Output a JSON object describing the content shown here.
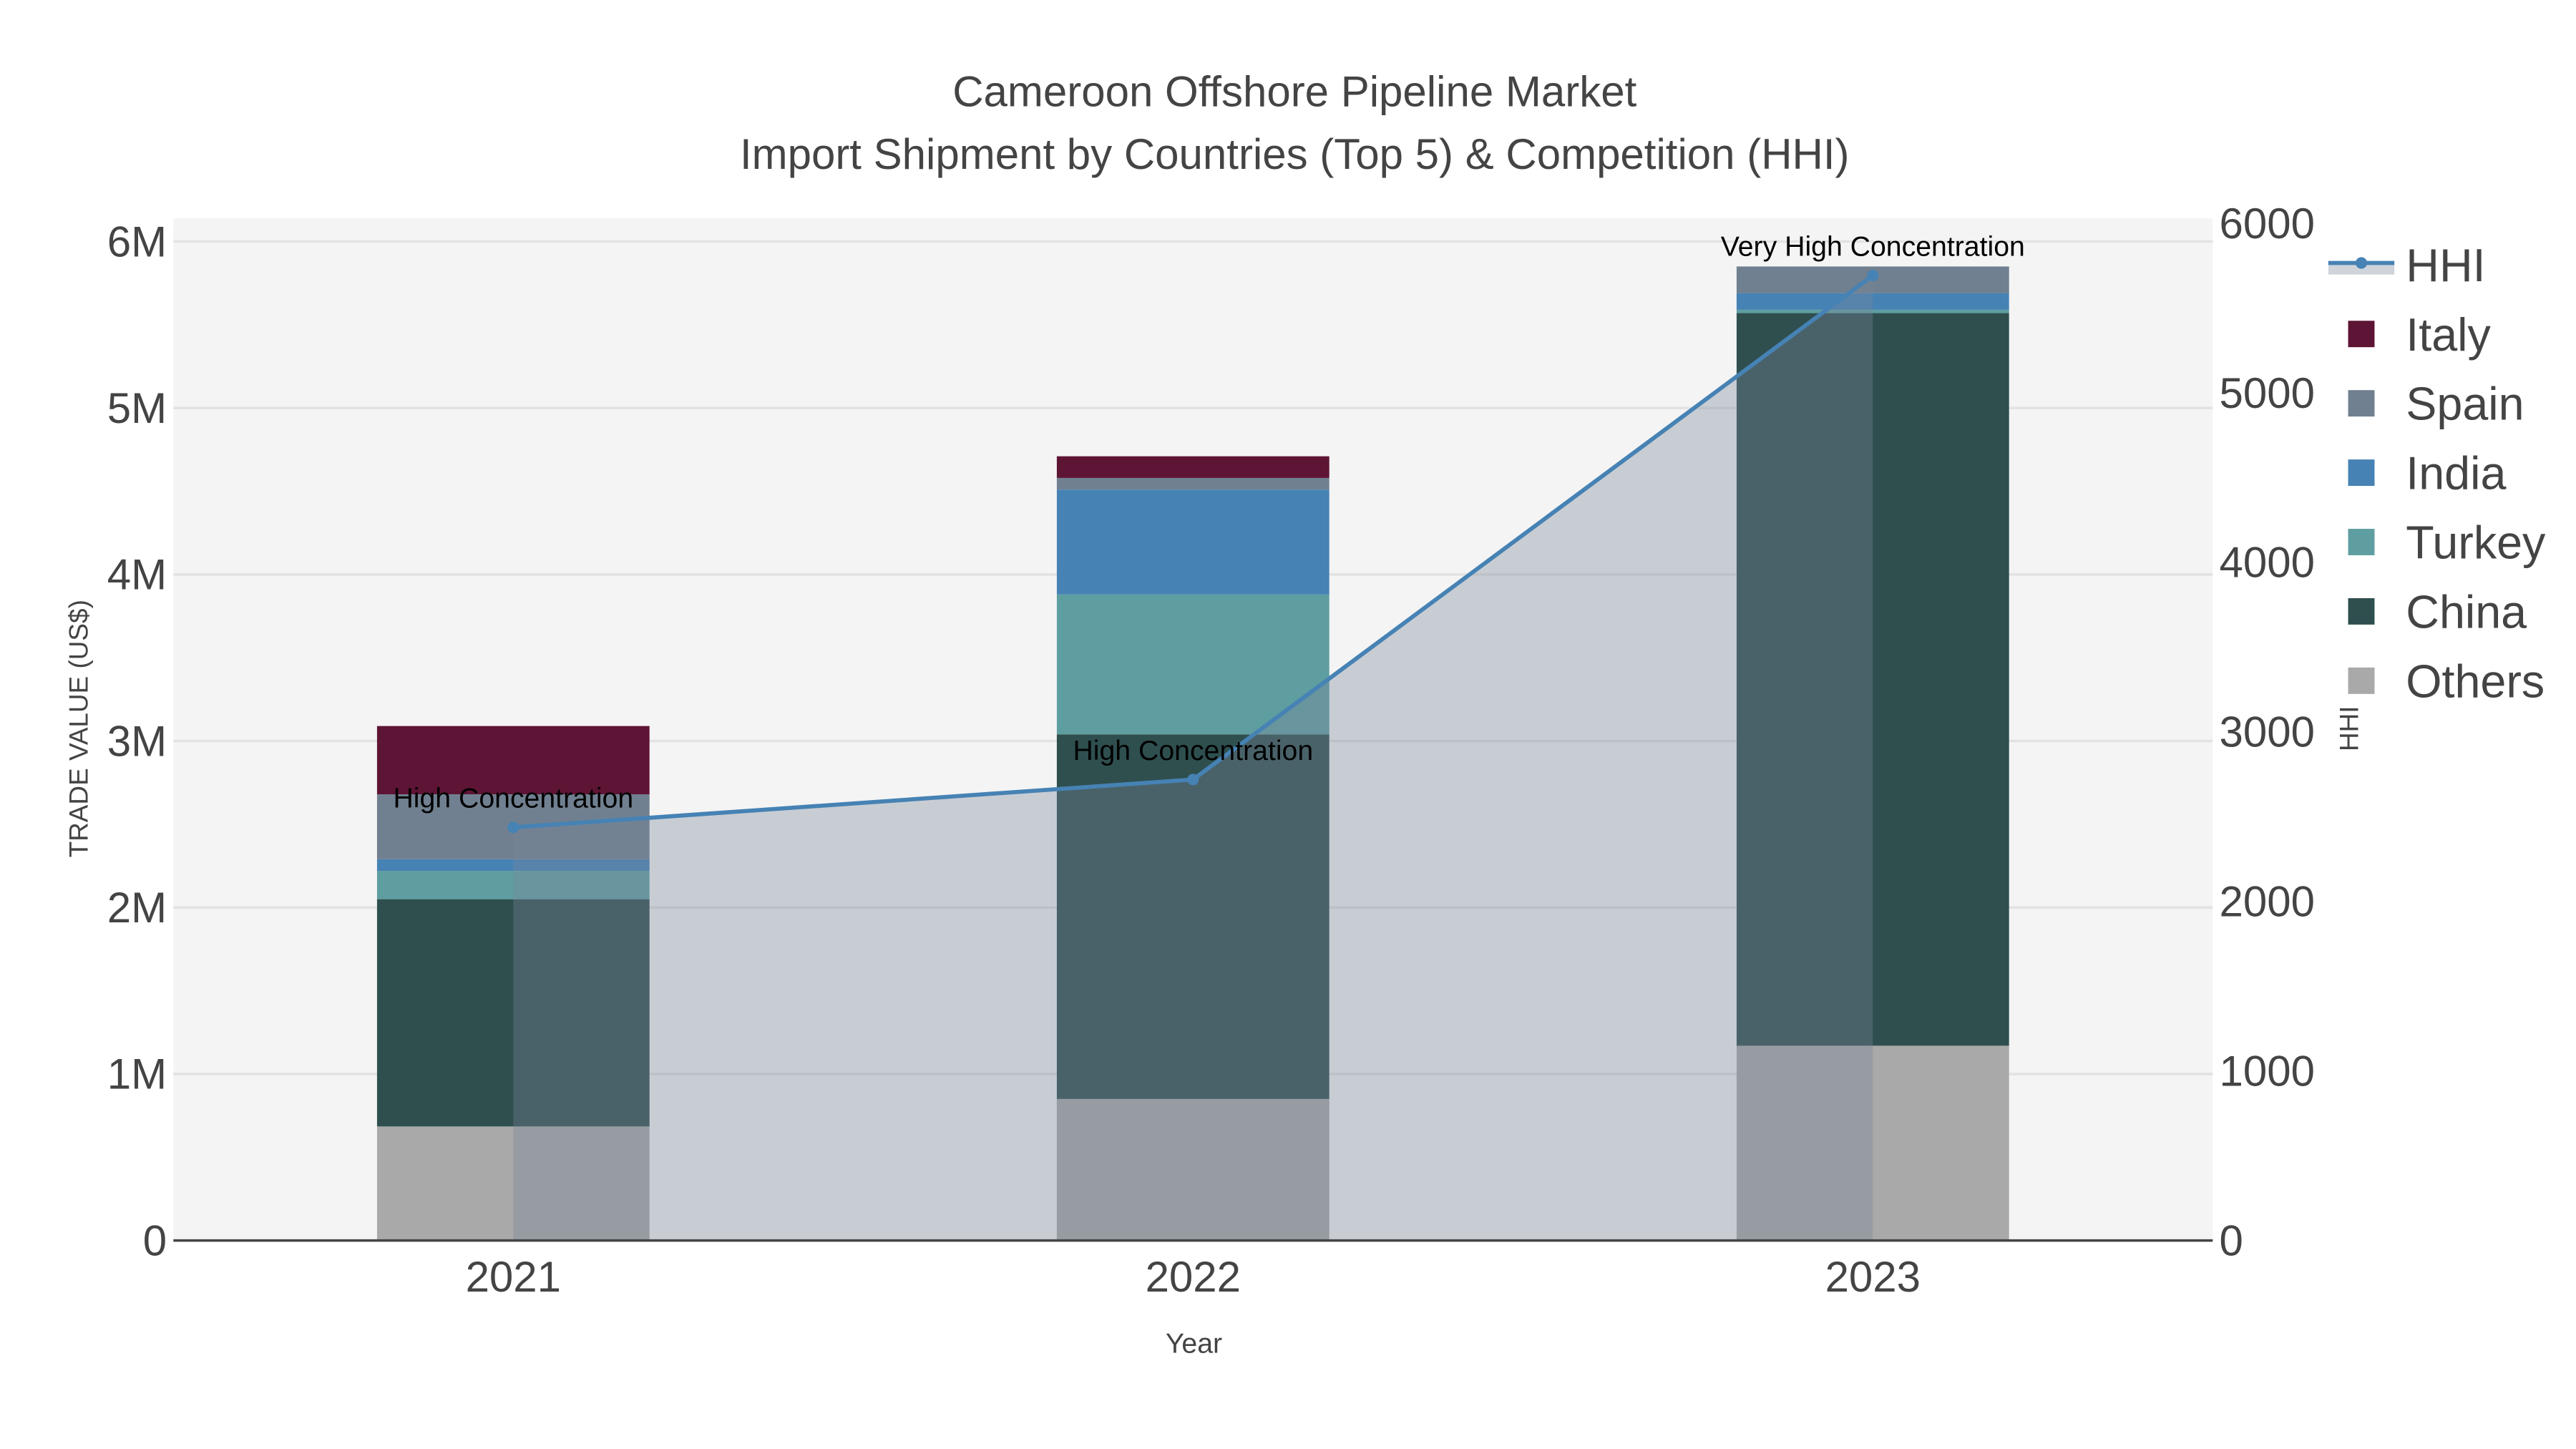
{
  "chart_data": {
    "type": "bar",
    "title": "Cameroon Offshore Pipeline Market",
    "subtitle": "Import Shipment by Countries (Top 5) & Competition (HHI)",
    "xlabel": "Year",
    "ylabel": "TRADE VALUE (US$)",
    "y2label": "HHI",
    "categories": [
      "2021",
      "2022",
      "2023"
    ],
    "stacked": true,
    "ylim": [
      0,
      6150000
    ],
    "y_ticks": [
      0,
      1000000,
      2000000,
      3000000,
      4000000,
      5000000,
      6000000
    ],
    "y_tick_labels": [
      "0",
      "1M",
      "2M",
      "3M",
      "4M",
      "5M",
      "6M"
    ],
    "y2lim": [
      0,
      6000
    ],
    "y2_ticks": [
      0,
      1000,
      2000,
      3000,
      4000,
      5000,
      6000
    ],
    "y2_tick_labels": [
      "0",
      "1000",
      "2000",
      "3000",
      "4000",
      "5000",
      "6000"
    ],
    "grid": true,
    "legend_position": "right",
    "series": [
      {
        "name": "Others",
        "color": "#a9a9a9",
        "values": [
          685000,
          850000,
          1170000
        ]
      },
      {
        "name": "China",
        "color": "#2f4f4f",
        "values": [
          1365000,
          2190000,
          4400000
        ]
      },
      {
        "name": "Turkey",
        "color": "#5f9ea0",
        "values": [
          170000,
          840000,
          20000
        ]
      },
      {
        "name": "India",
        "color": "#4682b4",
        "values": [
          70000,
          630000,
          100000
        ]
      },
      {
        "name": "Spain",
        "color": "#708090",
        "values": [
          390000,
          70000,
          160000
        ]
      },
      {
        "name": "Italy",
        "color": "#5e1434",
        "values": [
          410000,
          130000,
          0
        ]
      }
    ],
    "hhi": {
      "name": "HHI",
      "type": "line-area",
      "color": "#4682b4",
      "values": [
        2437,
        2719,
        5692
      ],
      "annotations": [
        "High Concentration",
        "High Concentration",
        "Very High Concentration"
      ]
    },
    "legend_order": [
      "HHI",
      "Italy",
      "Spain",
      "India",
      "Turkey",
      "China",
      "Others"
    ]
  }
}
